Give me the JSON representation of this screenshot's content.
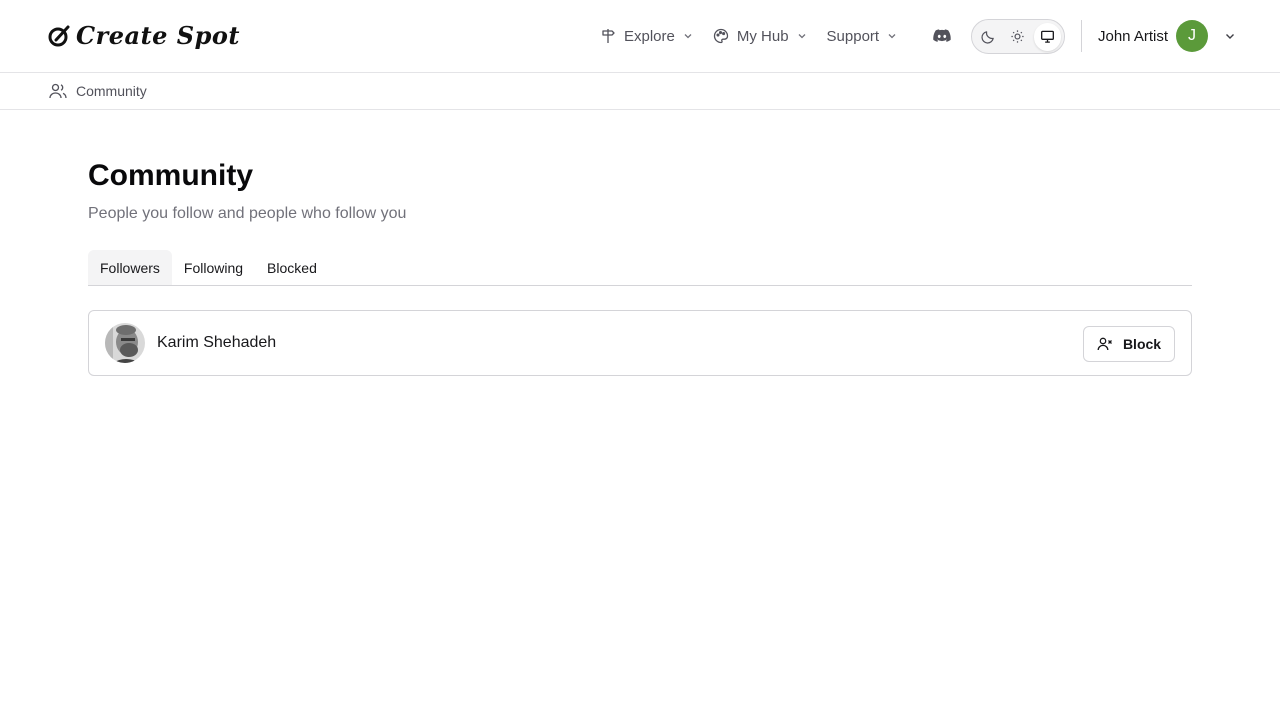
{
  "brand": {
    "name": "Create Spot"
  },
  "nav": {
    "items": [
      {
        "label": "Explore",
        "icon": "signpost-icon"
      },
      {
        "label": "My Hub",
        "icon": "palette-icon"
      },
      {
        "label": "Support",
        "icon": ""
      }
    ]
  },
  "theme": {
    "options": [
      "dark",
      "light",
      "system"
    ],
    "selected": "system"
  },
  "user": {
    "name": "John Artist",
    "initial": "J",
    "avatar_color": "#5b9a3a"
  },
  "breadcrumb": {
    "label": "Community",
    "icon": "users-icon"
  },
  "page": {
    "title": "Community",
    "subtitle": "People you follow and people who follow you"
  },
  "tabs": [
    {
      "label": "Followers",
      "active": true
    },
    {
      "label": "Following",
      "active": false
    },
    {
      "label": "Blocked",
      "active": false
    }
  ],
  "followers": [
    {
      "name": "Karim Shehadeh",
      "action_label": "Block"
    }
  ],
  "colors": {
    "border": "#d4d4d8",
    "muted_text": "#71717a",
    "active_tab_bg": "#f4f4f5"
  }
}
